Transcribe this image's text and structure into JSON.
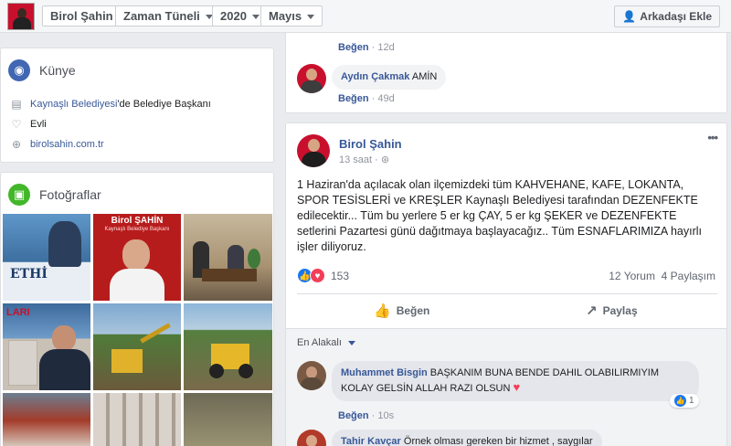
{
  "topbar": {
    "profile_name": "Birol Şahin",
    "timeline": "Zaman Tüneli",
    "year": "2020",
    "month": "Mayıs",
    "add_friend": "Arkadaşı Ekle",
    "add_friend_icon": "add-friend-icon"
  },
  "kunye": {
    "title": "Künye",
    "work_link": "Kaynaşlı Belediyesi",
    "work_suffix": "'de Belediye Başkanı",
    "relationship": "Evli",
    "website": "birolsahin.com.tr"
  },
  "photos": {
    "title": "Fotoğraflar",
    "thumb1_text": "ETHİ",
    "thumb2_title": "Birol ŞAHİN",
    "thumb2_sub": "Kaynaşlı Belediye Başkanı",
    "thumb4_text": "LARI"
  },
  "prev_comments": {
    "like1": "Beğen",
    "time1": "12d",
    "c2_author": "Aydın Çakmak",
    "c2_text": "AMİN",
    "like2": "Beğen",
    "time2": "49d"
  },
  "post": {
    "author": "Birol Şahin",
    "time": "13 saat",
    "more": "•••",
    "text": "1 Haziran'da açılacak olan ilçemizdeki tüm KAHVEHANE, KAFE, LOKANTA, SPOR TESİSLERİ ve KREŞLER Kaynaşlı Belediyesi tarafından DEZENFEKTE edilecektir... Tüm bu yerlere 5 er kg ÇAY, 5 er kg ŞEKER ve DEZENFEKTE setlerini Pazartesi günü dağıtmaya başlayacağız.. Tüm ESNAFLARIMIZA hayırlı işler diliyoruz.",
    "reaction_count": "153",
    "comments_count": "12 Yorum",
    "shares_count": "4 Paylaşım",
    "like_label": "Beğen",
    "share_label": "Paylaş",
    "sort_label": "En Alakalı"
  },
  "comments": [
    {
      "author": "Muhammet Bisgin",
      "text": "BAŞKANIM BUNA BENDE DAHIL OLABILIRMIYIM KOLAY GELSİN ALLAH RAZI OLSUN",
      "heart": "♥",
      "like": "Beğen",
      "time": "10s",
      "reactions": "1"
    },
    {
      "author": "Tahir Kavçar",
      "text": "Örnek olması gereken bir hizmet , saygılar"
    }
  ],
  "colors": {
    "link": "#385898",
    "like_blue": "#1877f2",
    "love_red": "#f33e58",
    "brand_red": "#c8102e"
  }
}
